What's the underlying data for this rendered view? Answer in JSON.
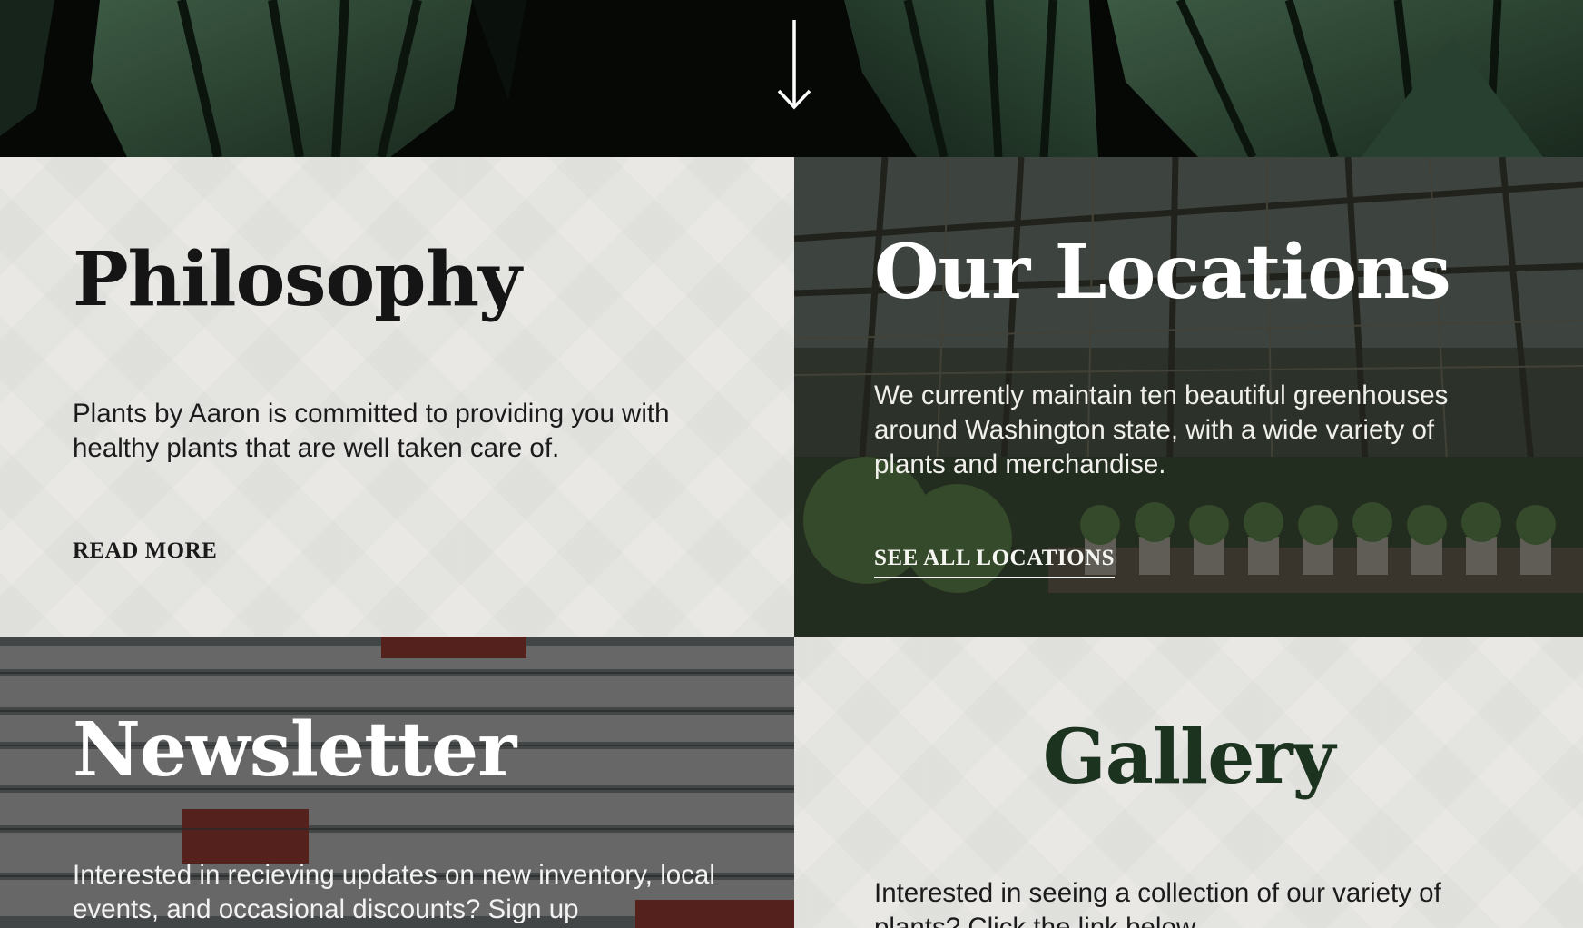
{
  "hero": {
    "scroll_icon": "arrow-down-icon"
  },
  "philosophy": {
    "title": "Philosophy",
    "text": "Plants by Aaron is committed to providing you with healthy plants that are well taken care of.",
    "link": "READ MORE"
  },
  "locations": {
    "title": "Our Locations",
    "text": "We currently maintain ten beautiful greenhouses around Washington state, with a wide variety of plants and merchandise.",
    "link": "SEE ALL LOCATIONS"
  },
  "newsletter": {
    "title": "Newsletter",
    "text": "Interested in recieving updates on new inventory, local events, and occasional discounts? Sign up"
  },
  "gallery": {
    "title": "Gallery",
    "text": "Interested in seeing a collection of our variety of plants? Click the link below."
  },
  "colors": {
    "panel_light": "#e9e8e5",
    "heading_dark": "#151515",
    "gallery_green": "#1c3320",
    "hero_dark": "#060806"
  }
}
